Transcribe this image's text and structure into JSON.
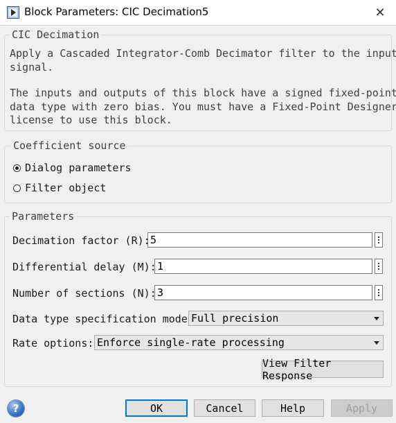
{
  "window": {
    "title": "Block Parameters: CIC Decimation5",
    "close_glyph": "✕"
  },
  "block": {
    "name": "CIC Decimation",
    "description_line1": "Apply a Cascaded Integrator-Comb Decimator filter to the input",
    "description_line2": "signal.",
    "description_line3": "The inputs and outputs of this block have a signed fixed-point",
    "description_line4": "data type with zero bias. You must have a Fixed-Point Designer",
    "description_line5": "license to use this block."
  },
  "coefficient_source": {
    "legend": "Coefficient source",
    "options": [
      {
        "label": "Dialog parameters",
        "selected": true
      },
      {
        "label": "Filter object",
        "selected": false
      }
    ]
  },
  "parameters": {
    "legend": "Parameters",
    "decimation_factor": {
      "label": "Decimation factor (R):",
      "value": "5"
    },
    "differential_delay": {
      "label": "Differential delay (M):",
      "value": "1"
    },
    "number_of_sections": {
      "label": "Number of sections (N):",
      "value": "3"
    },
    "data_type_mode": {
      "label": "Data type specification mode:",
      "value": "Full precision"
    },
    "rate_options": {
      "label": "Rate options:",
      "value": "Enforce single-rate processing"
    },
    "view_filter_response_label": "View Filter Response"
  },
  "footer": {
    "help_glyph": "?",
    "ok_label": "OK",
    "cancel_label": "Cancel",
    "help_label": "Help",
    "apply_label": "Apply"
  },
  "icons": {
    "app": "block-parameters-icon",
    "close": "close-icon",
    "help": "help-icon",
    "more": "more-options-icon",
    "dropdown": "chevron-down-icon"
  },
  "colors": {
    "default_button_border": "#0078d7",
    "dialog_background": "#f0f0f0"
  }
}
